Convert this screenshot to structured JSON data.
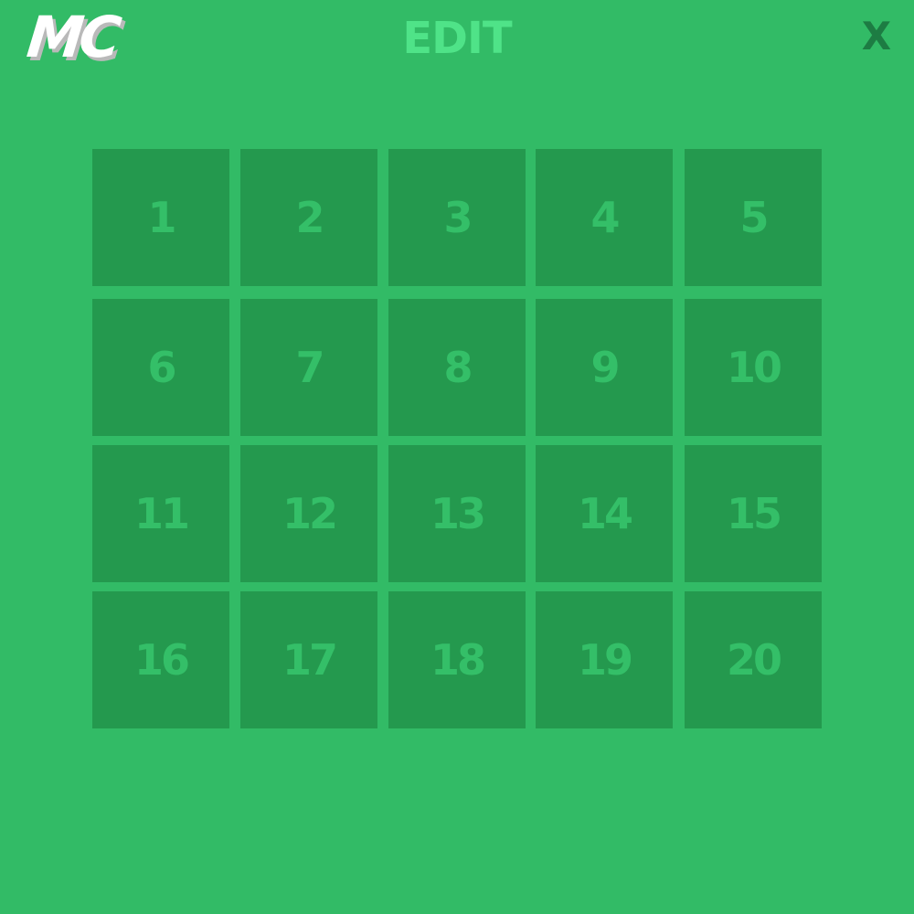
{
  "header": {
    "logo_text": "MC",
    "title": "EDIT",
    "close_label": "X"
  },
  "levels": [
    "1",
    "2",
    "3",
    "4",
    "5",
    "6",
    "7",
    "8",
    "9",
    "10",
    "11",
    "12",
    "13",
    "14",
    "15",
    "16",
    "17",
    "18",
    "19",
    "20"
  ],
  "colors": {
    "background": "#32bb66",
    "tile": "#24994e",
    "tile_text": "#34bf68",
    "title": "#4fe388",
    "close": "#1d7c43",
    "logo": "#ffffff",
    "logo_shadow": "#b9b9b9"
  }
}
